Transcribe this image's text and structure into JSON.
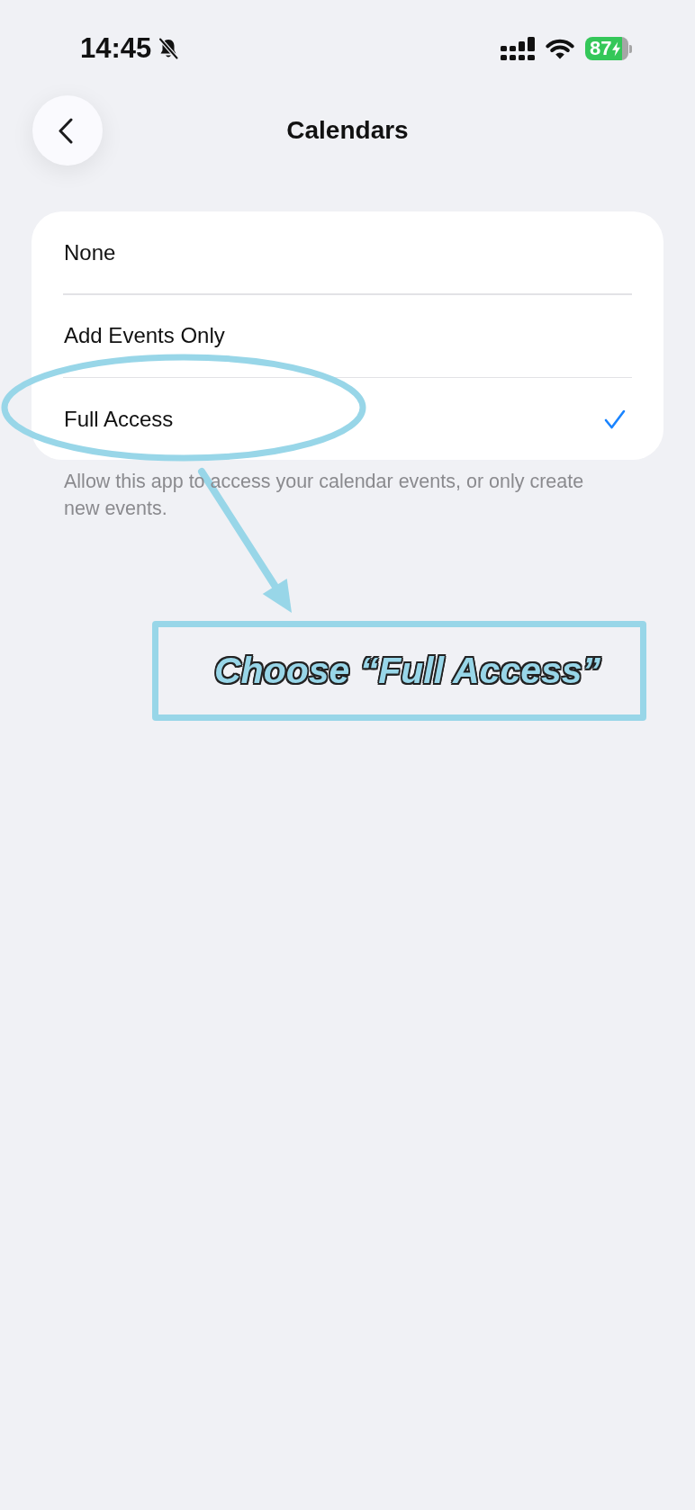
{
  "status_bar": {
    "time": "14:45",
    "silent": true,
    "battery": "87",
    "charging": true
  },
  "nav": {
    "title": "Calendars"
  },
  "options": [
    {
      "label": "None",
      "selected": false
    },
    {
      "label": "Add Events Only",
      "selected": false
    },
    {
      "label": "Full Access",
      "selected": true
    }
  ],
  "footer": "Allow this app to access your calendar events, or only create new events.",
  "annotation": {
    "callout": "Choose “Full Access”"
  }
}
